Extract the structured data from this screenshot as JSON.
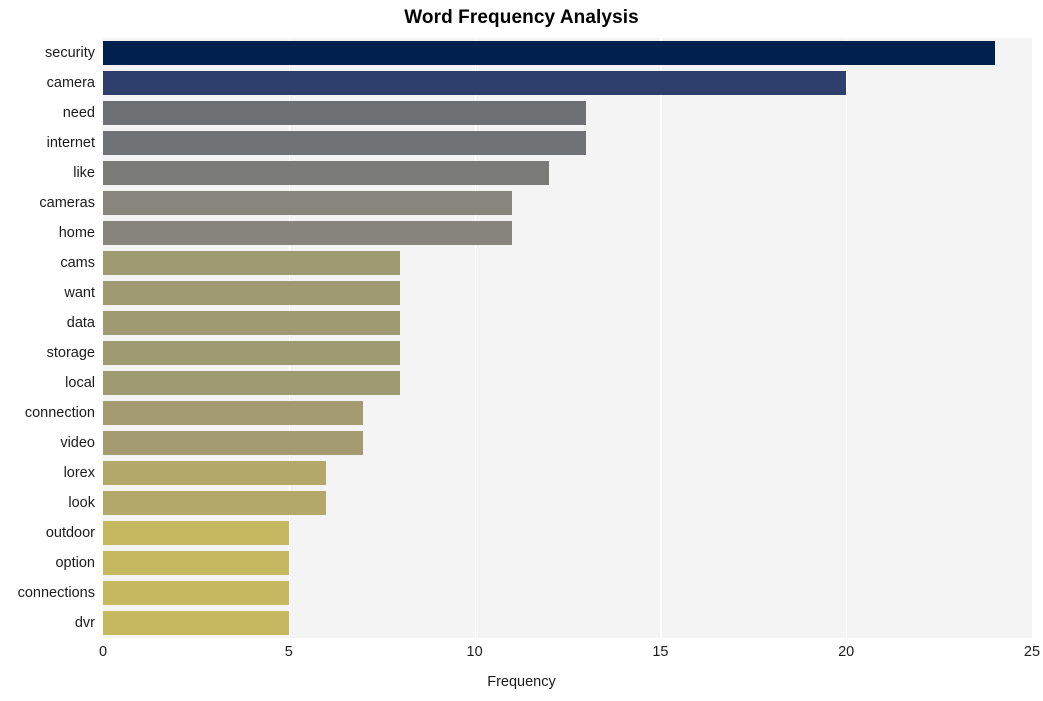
{
  "chart_data": {
    "type": "bar",
    "orientation": "horizontal",
    "title": "Word Frequency Analysis",
    "xlabel": "Frequency",
    "ylabel": "",
    "categories": [
      "security",
      "camera",
      "need",
      "internet",
      "like",
      "cameras",
      "home",
      "cams",
      "want",
      "data",
      "storage",
      "local",
      "connection",
      "video",
      "lorex",
      "look",
      "outdoor",
      "option",
      "connections",
      "dvr"
    ],
    "values": [
      24,
      20,
      13,
      13,
      12,
      11,
      11,
      8,
      8,
      8,
      8,
      8,
      7,
      7,
      6,
      6,
      5,
      5,
      5,
      5
    ],
    "bar_colors": [
      "#00214e",
      "#2e3f6b",
      "#6e7074",
      "#717276",
      "#7a7a78",
      "#87867c",
      "#85857b",
      "#a09a72",
      "#a09a72",
      "#a09a72",
      "#a09a72",
      "#a09a72",
      "#a49c70",
      "#a49c70",
      "#b3a869",
      "#b3a869",
      "#c5b860",
      "#c5b860",
      "#c5b860",
      "#c5b860"
    ],
    "xlim": [
      0,
      25
    ],
    "xticks": [
      0,
      5,
      10,
      15,
      20,
      25
    ],
    "xtick_labels": [
      "0",
      "5",
      "10",
      "15",
      "20",
      "25"
    ],
    "grid": true,
    "grid_axis": "x",
    "legend": null,
    "plot_background": "#f4f4f5",
    "figure_background": "#ffffff"
  }
}
